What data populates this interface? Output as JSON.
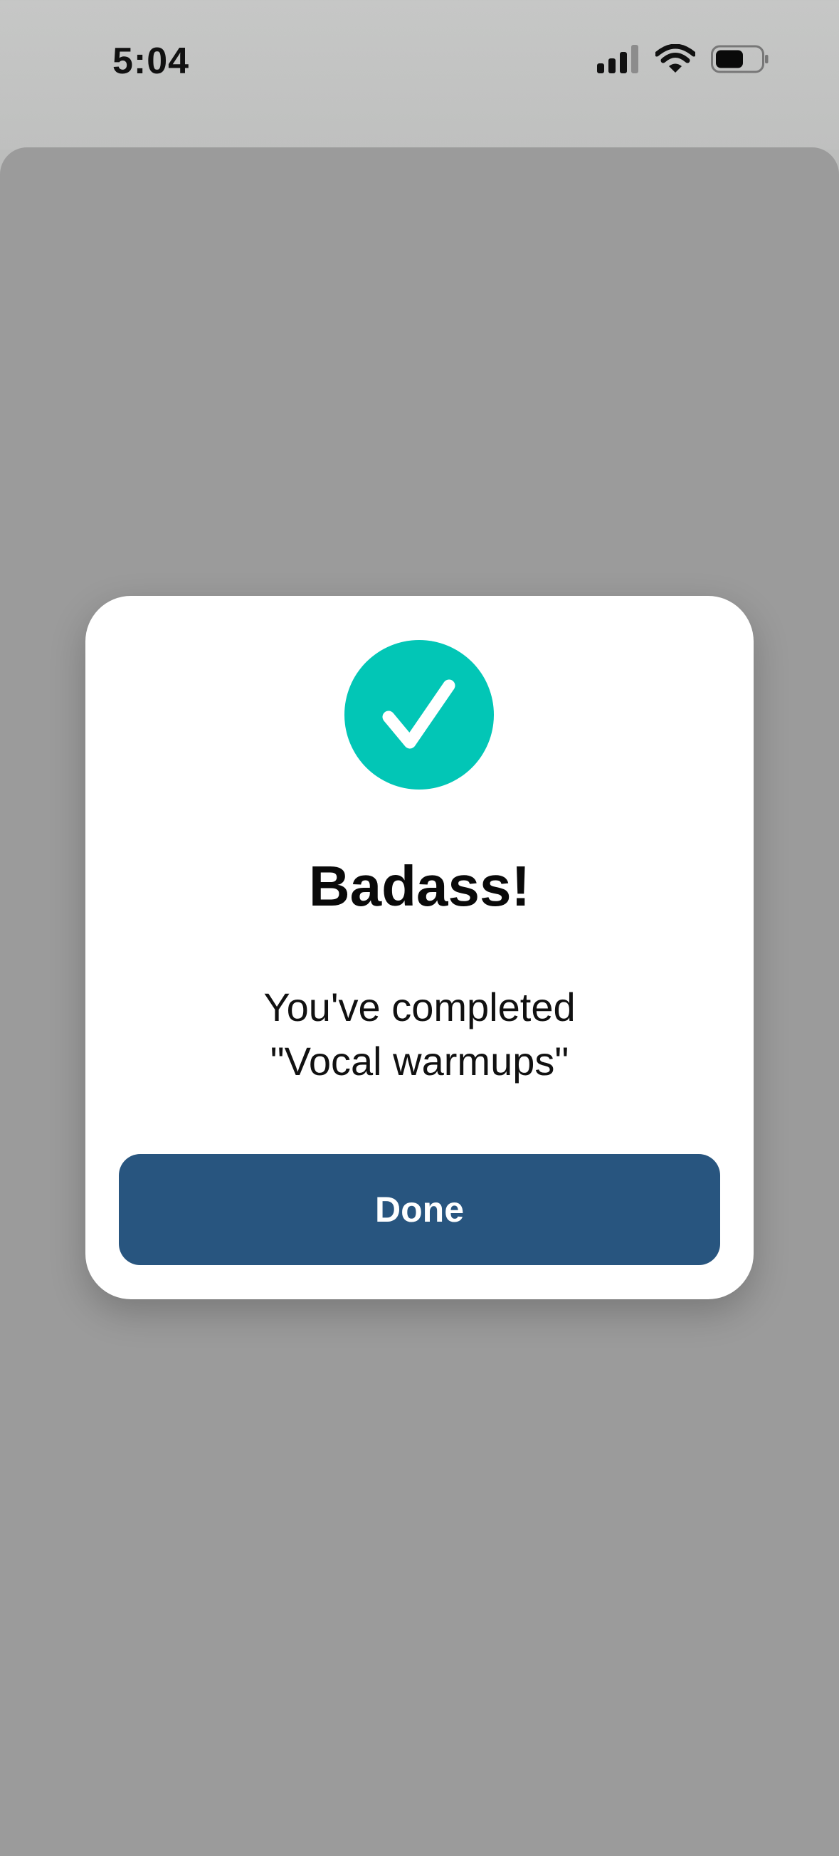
{
  "status_bar": {
    "time": "5:04",
    "icons": [
      "cellular-signal-icon",
      "wifi-icon",
      "battery-icon"
    ]
  },
  "dialog": {
    "icon": "checkmark-icon",
    "title": "Badass!",
    "message_line1": "You've completed",
    "message_line2": "\"Vocal warmups\"",
    "done_label": "Done"
  },
  "colors": {
    "accent_teal": "#02C6B6",
    "button_blue": "#28557F",
    "overlay_gray": "#9B9B9B"
  }
}
